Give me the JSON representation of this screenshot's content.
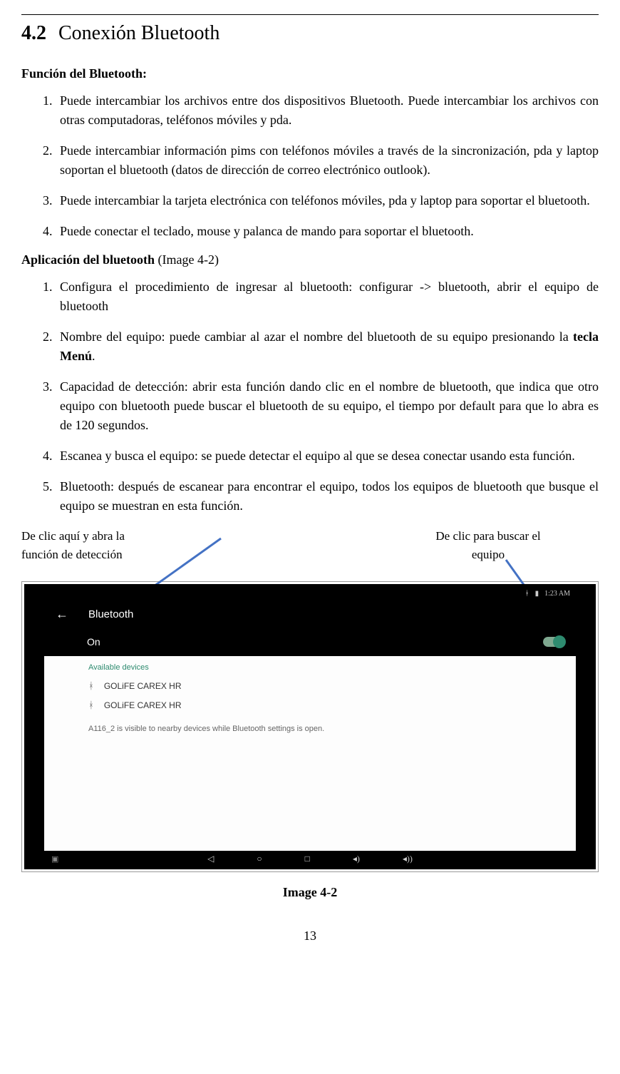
{
  "section_number": "4.2",
  "section_title": "Conexión Bluetooth",
  "func_heading": "Función del Bluetooth:",
  "func_items": [
    "Puede intercambiar los archivos entre dos dispositivos Bluetooth. Puede intercambiar los archivos con otras computadoras, teléfonos móviles y pda.",
    "Puede intercambiar información pims con teléfonos móviles a través de la sincronización, pda y laptop soportan el bluetooth (datos de dirección de correo electrónico outlook).",
    "Puede intercambiar la tarjeta electrónica con teléfonos móviles, pda y laptop para soportar el bluetooth.",
    "Puede conectar el teclado, mouse y palanca de mando para soportar el bluetooth."
  ],
  "app_heading_bold": "Aplicación del bluetooth",
  "app_heading_light": " (Image 4-2)",
  "app_items": [
    {
      "pre": "Configura el procedimiento de ingresar al bluetooth: configurar -> bluetooth, abrir el equipo de bluetooth",
      "bold": "",
      "post": ""
    },
    {
      "pre": "Nombre del equipo: puede cambiar al azar el nombre del bluetooth de su equipo presionando la ",
      "bold": "tecla Menú",
      "post": "."
    },
    {
      "pre": "Capacidad de detección: abrir esta función dando clic en el nombre de bluetooth, que indica que otro equipo con bluetooth puede buscar el bluetooth de su equipo, el tiempo por default para que lo abra es de 120 segundos.",
      "bold": "",
      "post": ""
    },
    {
      "pre": "Escanea y busca el equipo: se puede detectar el equipo al que se desea conectar usando esta función.",
      "bold": "",
      "post": ""
    },
    {
      "pre": "Bluetooth: después de escanear para encontrar el equipo, todos los equipos de bluetooth que busque el equipo se muestran en esta función.",
      "bold": "",
      "post": ""
    }
  ],
  "callout_left": "De clic aquí y abra la función de detección",
  "callout_right": "De clic para buscar el equipo",
  "screenshot": {
    "clock": "1:23 AM",
    "title": "Bluetooth",
    "state": "On",
    "available_label": "Available devices",
    "devices": [
      "GOLiFE CAREX HR",
      "GOLiFE CAREX HR"
    ],
    "visible_note": "A116_2 is visible to nearby devices while Bluetooth settings is open."
  },
  "image_caption": "Image 4-2",
  "page_number": "13"
}
